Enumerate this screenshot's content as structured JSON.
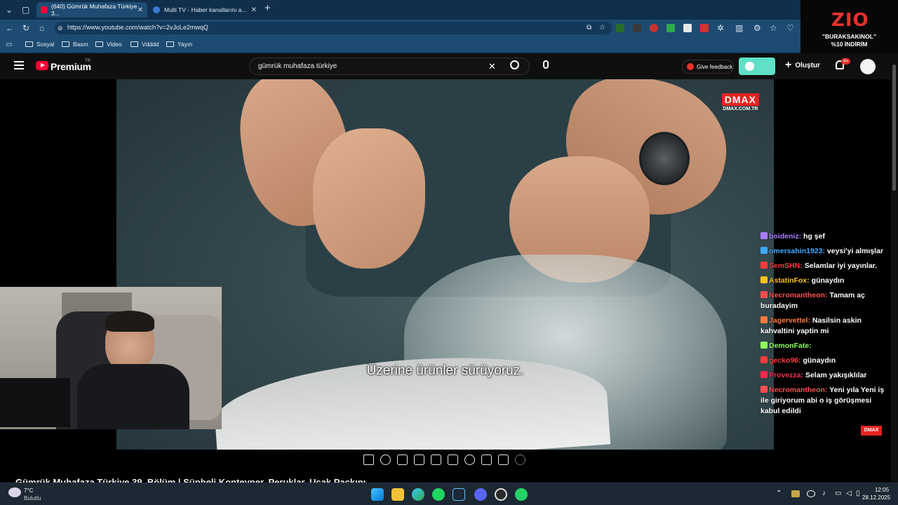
{
  "browser": {
    "tabs": [
      {
        "title": "(640) Gümrük Muhafaza Türkiye 3...",
        "active": true
      },
      {
        "title": "Multi TV - Haber kanallarını a...",
        "active": false
      }
    ],
    "url": "https://www.youtube.com/watch?v=2vJoLe2mwqQ",
    "bookmarks": [
      "Sosyal",
      "Basın",
      "Video",
      "Vdddd",
      "Yayın"
    ]
  },
  "promo": {
    "logo": "ZIO",
    "line1": "\"BURAKSAKINOL\"",
    "line2": "%10 İNDİRİM"
  },
  "youtube": {
    "logo_text": "Premium",
    "region": "TR",
    "search_value": "gümrük muhafaza türkiye",
    "feedback_label": "Give feedback",
    "create_label": "Oluştur",
    "notif_count": "9+"
  },
  "video": {
    "channel_logo": "DMAX",
    "channel_site": "DMAX.COM.TR",
    "subtitle": "Üzerine ürünler sürüyoruz.",
    "title": "Gümrük Muhafaza Türkiye 39. Bölüm | Şüpheli Konteyner, Peruklar, Uçak Paçkını"
  },
  "chat": {
    "messages": [
      {
        "user": "boideniz:",
        "text": "hg şef",
        "color": "#a87cff"
      },
      {
        "user": "omersahin1923:",
        "text": "veysi'yi almışlar",
        "color": "#3fa9ff"
      },
      {
        "user": "SemSHN:",
        "text": "Selamlar iyi yayınlar.",
        "color": "#ff3d3d"
      },
      {
        "user": "AstatinFox:",
        "text": "günaydın",
        "color": "#ffc21a"
      },
      {
        "user": "Necromantheon:",
        "text": "Tamam aç buradayim",
        "color": "#ff4d4d"
      },
      {
        "user": "Jagervettel:",
        "text": "Nasilsin askin kahvaltini yaptin mi",
        "color": "#ff7a3d"
      },
      {
        "user": "DemonFate:",
        "text": "",
        "color": "#8cff5a"
      },
      {
        "user": "gecko96:",
        "text": "günaydın",
        "color": "#ff3d3d"
      },
      {
        "user": "Provezza:",
        "text": "Selam yakışıklılar",
        "color": "#ff2a4d"
      },
      {
        "user": "Necromantheon:",
        "text": "Yeni yıla Yeni iş ile giriyorum abi o iş görüşmesi kabul edildi",
        "color": "#ff4d4d"
      }
    ]
  },
  "taskbar": {
    "weather_temp": "7°C",
    "weather_desc": "Bulutlu",
    "time": "12:05",
    "date": "28.12.2025"
  }
}
